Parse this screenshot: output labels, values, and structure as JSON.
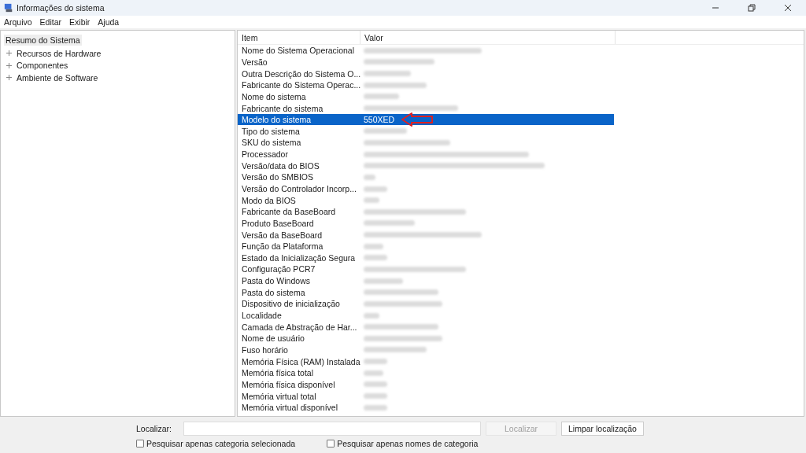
{
  "window": {
    "title": "Informações do sistema"
  },
  "menu": [
    "Arquivo",
    "Editar",
    "Exibir",
    "Ajuda"
  ],
  "tree": [
    {
      "label": "Resumo do Sistema",
      "selected": true,
      "children": [
        {
          "label": "Recursos de Hardware",
          "selected": false,
          "expanded": false
        },
        {
          "label": "Componentes",
          "selected": false,
          "expanded": false
        },
        {
          "label": "Ambiente de Software",
          "selected": false,
          "expanded": false
        }
      ]
    }
  ],
  "table": {
    "columns": [
      "Item",
      "Valor"
    ],
    "rows": [
      {
        "item": "Nome do Sistema Operacional",
        "redacted": true,
        "selected": false
      },
      {
        "item": "Versão",
        "redacted": true,
        "selected": false
      },
      {
        "item": "Outra Descrição do Sistema O...",
        "redacted": true,
        "selected": false
      },
      {
        "item": "Fabricante do Sistema Operac...",
        "redacted": true,
        "selected": false
      },
      {
        "item": "Nome do sistema",
        "redacted": true,
        "selected": false
      },
      {
        "item": "Fabricante do sistema",
        "redacted": true,
        "selected": false
      },
      {
        "item": "Modelo do sistema",
        "value": "550XED",
        "redacted": false,
        "selected": true
      },
      {
        "item": "Tipo do sistema",
        "redacted": true,
        "selected": false
      },
      {
        "item": "SKU do sistema",
        "redacted": true,
        "selected": false
      },
      {
        "item": "Processador",
        "redacted": true,
        "selected": false
      },
      {
        "item": "Versão/data do BIOS",
        "redacted": true,
        "selected": false
      },
      {
        "item": "Versão do SMBIOS",
        "redacted": true,
        "selected": false
      },
      {
        "item": "Versão do Controlador Incorp...",
        "redacted": true,
        "selected": false
      },
      {
        "item": "Modo da BIOS",
        "redacted": true,
        "selected": false
      },
      {
        "item": "Fabricante da BaseBoard",
        "redacted": true,
        "selected": false
      },
      {
        "item": "Produto BaseBoard",
        "redacted": true,
        "selected": false
      },
      {
        "item": "Versão da BaseBoard",
        "redacted": true,
        "selected": false
      },
      {
        "item": "Função da Plataforma",
        "redacted": true,
        "selected": false
      },
      {
        "item": "Estado da Inicialização Segura",
        "redacted": true,
        "selected": false
      },
      {
        "item": "Configuração PCR7",
        "redacted": true,
        "selected": false
      },
      {
        "item": "Pasta do Windows",
        "redacted": true,
        "selected": false
      },
      {
        "item": "Pasta do sistema",
        "redacted": true,
        "selected": false
      },
      {
        "item": "Dispositivo de inicialização",
        "redacted": true,
        "selected": false
      },
      {
        "item": "Localidade",
        "redacted": true,
        "selected": false
      },
      {
        "item": "Camada de Abstração de Har...",
        "redacted": true,
        "selected": false
      },
      {
        "item": "Nome de usuário",
        "redacted": true,
        "selected": false
      },
      {
        "item": "Fuso horário",
        "redacted": true,
        "selected": false
      },
      {
        "item": "Memória Física (RAM) Instalada",
        "redacted": true,
        "selected": false
      },
      {
        "item": "Memória física total",
        "redacted": true,
        "selected": false
      },
      {
        "item": "Memória física disponível",
        "redacted": true,
        "selected": false
      },
      {
        "item": "Memória virtual total",
        "redacted": true,
        "selected": false
      },
      {
        "item": "Memória virtual disponível",
        "redacted": true,
        "selected": false
      }
    ]
  },
  "find": {
    "label": "Localizar:",
    "find_button": {
      "label": "Localizar",
      "disabled": true
    },
    "clear_button": {
      "label": "Limpar localização",
      "disabled": false
    },
    "options": [
      {
        "label": "Pesquisar apenas categoria selecionada",
        "checked": false
      },
      {
        "label": "Pesquisar apenas nomes de categoria",
        "checked": false
      }
    ]
  }
}
